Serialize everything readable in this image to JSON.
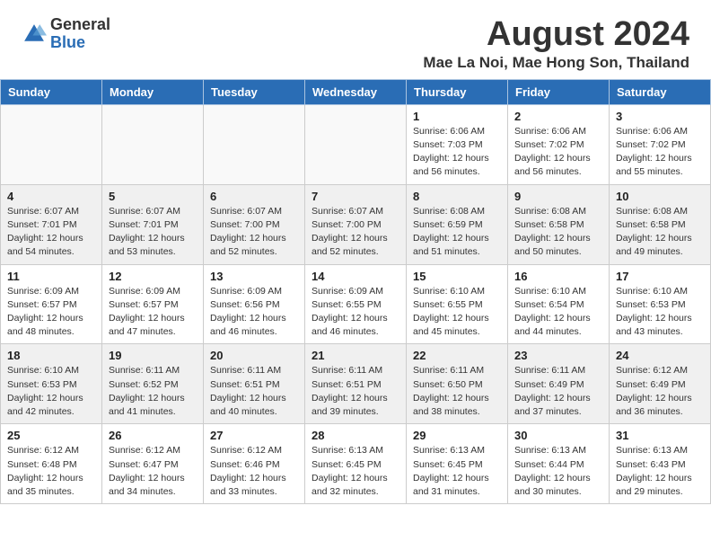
{
  "header": {
    "logo_general": "General",
    "logo_blue": "Blue",
    "main_title": "August 2024",
    "subtitle": "Mae La Noi, Mae Hong Son, Thailand"
  },
  "weekdays": [
    "Sunday",
    "Monday",
    "Tuesday",
    "Wednesday",
    "Thursday",
    "Friday",
    "Saturday"
  ],
  "weeks": [
    [
      {
        "day": "",
        "info": ""
      },
      {
        "day": "",
        "info": ""
      },
      {
        "day": "",
        "info": ""
      },
      {
        "day": "",
        "info": ""
      },
      {
        "day": "1",
        "info": "Sunrise: 6:06 AM\nSunset: 7:03 PM\nDaylight: 12 hours\nand 56 minutes."
      },
      {
        "day": "2",
        "info": "Sunrise: 6:06 AM\nSunset: 7:02 PM\nDaylight: 12 hours\nand 56 minutes."
      },
      {
        "day": "3",
        "info": "Sunrise: 6:06 AM\nSunset: 7:02 PM\nDaylight: 12 hours\nand 55 minutes."
      }
    ],
    [
      {
        "day": "4",
        "info": "Sunrise: 6:07 AM\nSunset: 7:01 PM\nDaylight: 12 hours\nand 54 minutes."
      },
      {
        "day": "5",
        "info": "Sunrise: 6:07 AM\nSunset: 7:01 PM\nDaylight: 12 hours\nand 53 minutes."
      },
      {
        "day": "6",
        "info": "Sunrise: 6:07 AM\nSunset: 7:00 PM\nDaylight: 12 hours\nand 52 minutes."
      },
      {
        "day": "7",
        "info": "Sunrise: 6:07 AM\nSunset: 7:00 PM\nDaylight: 12 hours\nand 52 minutes."
      },
      {
        "day": "8",
        "info": "Sunrise: 6:08 AM\nSunset: 6:59 PM\nDaylight: 12 hours\nand 51 minutes."
      },
      {
        "day": "9",
        "info": "Sunrise: 6:08 AM\nSunset: 6:58 PM\nDaylight: 12 hours\nand 50 minutes."
      },
      {
        "day": "10",
        "info": "Sunrise: 6:08 AM\nSunset: 6:58 PM\nDaylight: 12 hours\nand 49 minutes."
      }
    ],
    [
      {
        "day": "11",
        "info": "Sunrise: 6:09 AM\nSunset: 6:57 PM\nDaylight: 12 hours\nand 48 minutes."
      },
      {
        "day": "12",
        "info": "Sunrise: 6:09 AM\nSunset: 6:57 PM\nDaylight: 12 hours\nand 47 minutes."
      },
      {
        "day": "13",
        "info": "Sunrise: 6:09 AM\nSunset: 6:56 PM\nDaylight: 12 hours\nand 46 minutes."
      },
      {
        "day": "14",
        "info": "Sunrise: 6:09 AM\nSunset: 6:55 PM\nDaylight: 12 hours\nand 46 minutes."
      },
      {
        "day": "15",
        "info": "Sunrise: 6:10 AM\nSunset: 6:55 PM\nDaylight: 12 hours\nand 45 minutes."
      },
      {
        "day": "16",
        "info": "Sunrise: 6:10 AM\nSunset: 6:54 PM\nDaylight: 12 hours\nand 44 minutes."
      },
      {
        "day": "17",
        "info": "Sunrise: 6:10 AM\nSunset: 6:53 PM\nDaylight: 12 hours\nand 43 minutes."
      }
    ],
    [
      {
        "day": "18",
        "info": "Sunrise: 6:10 AM\nSunset: 6:53 PM\nDaylight: 12 hours\nand 42 minutes."
      },
      {
        "day": "19",
        "info": "Sunrise: 6:11 AM\nSunset: 6:52 PM\nDaylight: 12 hours\nand 41 minutes."
      },
      {
        "day": "20",
        "info": "Sunrise: 6:11 AM\nSunset: 6:51 PM\nDaylight: 12 hours\nand 40 minutes."
      },
      {
        "day": "21",
        "info": "Sunrise: 6:11 AM\nSunset: 6:51 PM\nDaylight: 12 hours\nand 39 minutes."
      },
      {
        "day": "22",
        "info": "Sunrise: 6:11 AM\nSunset: 6:50 PM\nDaylight: 12 hours\nand 38 minutes."
      },
      {
        "day": "23",
        "info": "Sunrise: 6:11 AM\nSunset: 6:49 PM\nDaylight: 12 hours\nand 37 minutes."
      },
      {
        "day": "24",
        "info": "Sunrise: 6:12 AM\nSunset: 6:49 PM\nDaylight: 12 hours\nand 36 minutes."
      }
    ],
    [
      {
        "day": "25",
        "info": "Sunrise: 6:12 AM\nSunset: 6:48 PM\nDaylight: 12 hours\nand 35 minutes."
      },
      {
        "day": "26",
        "info": "Sunrise: 6:12 AM\nSunset: 6:47 PM\nDaylight: 12 hours\nand 34 minutes."
      },
      {
        "day": "27",
        "info": "Sunrise: 6:12 AM\nSunset: 6:46 PM\nDaylight: 12 hours\nand 33 minutes."
      },
      {
        "day": "28",
        "info": "Sunrise: 6:13 AM\nSunset: 6:45 PM\nDaylight: 12 hours\nand 32 minutes."
      },
      {
        "day": "29",
        "info": "Sunrise: 6:13 AM\nSunset: 6:45 PM\nDaylight: 12 hours\nand 31 minutes."
      },
      {
        "day": "30",
        "info": "Sunrise: 6:13 AM\nSunset: 6:44 PM\nDaylight: 12 hours\nand 30 minutes."
      },
      {
        "day": "31",
        "info": "Sunrise: 6:13 AM\nSunset: 6:43 PM\nDaylight: 12 hours\nand 29 minutes."
      }
    ]
  ]
}
